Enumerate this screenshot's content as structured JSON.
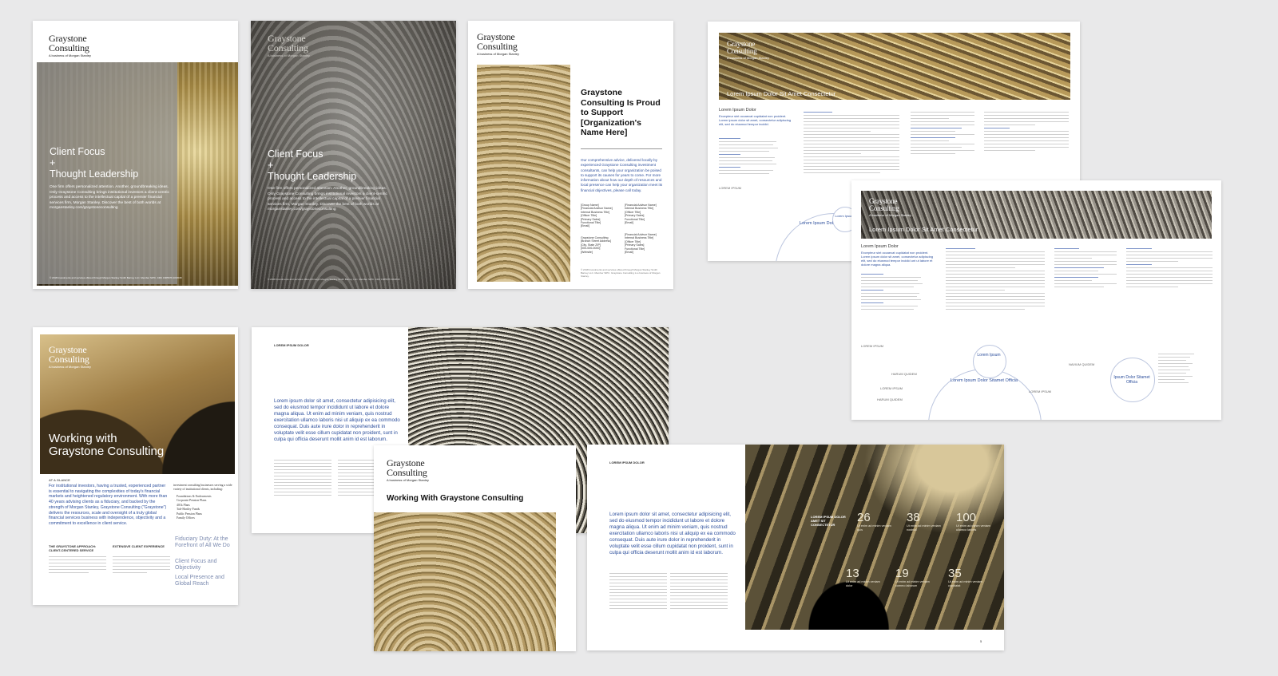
{
  "brand": {
    "name_line1": "Graystone",
    "name_line2": "Consulting",
    "tagline": "A business of Morgan Stanley"
  },
  "flyer1": {
    "title": "Client Focus\n+\nThought Leadership",
    "body": "One firm offers personalized attention. Another, groundbreaking ideas. Only Graystone Consulting brings institutional investors a client-centric process and access to the intellectual capital of a premier financial services firm, Morgan Stanley. Discover the best of both worlds at morganstanley.com/graystoneconsulting",
    "footer": "© 2018 Investments and services offered through Morgan Stanley Smith Barney LLC. Member SIPC. CRC 1665676 10/2018"
  },
  "flyer2": {
    "title": "Client Focus\n+\nThought Leadership",
    "body": "One firm offers personalized attention. Another, groundbreaking ideas. Only Graystone Consulting brings institutional investors a client-centric process and access to the intellectual capital of a premier financial services firm, Morgan Stanley. Discover the best of both worlds at morganstanley.com/graystoneconsulting",
    "footer": "© 2018 Investments and services offered through Morgan Stanley Smith Barney LLC. Member SIPC. CRC 1665676 10/2018"
  },
  "flyer3": {
    "title": "Graystone Consulting Is Proud to Support [Organization's Name Here]",
    "body": "Our comprehensive advice, delivered locally by experienced Graystone Consulting investment consultants, can help your organization be poised to support its causes for years to come. For more information about how our depth of resources and local presence can help your organization meet its financial objectives, please call today.",
    "contact1": "[Group Name]\n[Financial Advisor Name]\nInternal Business Title]\n[Officer Title]\n[Primary Sales]\nFunctional Title]\n[Email]",
    "contact2": "[Financial Advisor Name]\nInternal Business Title]\n[Officer Title]\n[Primary Sales]\nFunctional Title]\n[Email]",
    "contact3": "Graystone Consulting\n[Branch Street Address]\n[City, State ZIP]\n[000-000-0000]\n[Website]",
    "contact4": "[Financial Advisor Name]\nInternal Business Title]\n[Officer Title]\n[Primary Sales]\nFunctional Title]\n[Email]",
    "footer": "© 2018 Investments and services offered through Morgan Stanley Smith Barney LLC. Member SIPC. Graystone Consulting is a business of Morgan Stanley."
  },
  "spread1": {
    "banner_title": "Lorem Ipsum Dolor Sit Amet Consectetur",
    "section_title": "Lorem Ipsum Dolor",
    "intro": "Excepteur sint occaecat cupidatat non proident. Lorem ipsum dolor sit amet, consectetur adipiscing elit, sed do eiusmod tempor incidid.",
    "label": "LOREM IPSUM",
    "circle1": "Lorem Ipsum Dolor Sitamet Officia",
    "circle2": "Lorem Ipsum"
  },
  "spread2": {
    "banner_title": "Lorem Ipsum Dolor Sit Amet Consectetur",
    "section_title": "Lorem Ipsum Dolor",
    "intro": "Excepteur sint occaecat cupidatat non proident. Lorem ipsum dolor sit amet, consectetur adipiscing elit, sed do eiusmod tempor incidid unt ut labore et dolore magna aliqua.",
    "label": "LOREM IPSUM",
    "circle_left": "Lorem Ipsum Dolor Sitamet Officia",
    "circle_top": "Lorem Ipsum",
    "circle_right": "Ipsum Dolor Sitamet Officia",
    "small_labels": [
      "HARUM QUIDEM",
      "LOREM IPSUM",
      "NAVIUM QUIDEM",
      "HARUM QUIDEM",
      "LOREM IPSUM"
    ]
  },
  "working_flyer": {
    "title": "Working with\nGraystone Consulting",
    "label": "AT A GLANCE",
    "intro": "For institutional investors, having a trusted, experienced partner is essential to navigating the complexities of today's financial markets and heightened regulatory environment. With more than 40 years advising clients as a fiduciary, and backed by the strength of Morgan Stanley, Graystone Consulting (\"Graystone\") delivers the resources, scale and oversight of a truly global financial services business with independence, objectivity and a commitment to excellence in client service.",
    "list_intro": "investment consulting businesses serving a wide variety of institutional clients, including:",
    "list": [
      "Foundations & Endowments",
      "Corporate Pension Plans",
      "401k Plans",
      "Taft-Hartley Funds",
      "Public Pension Plans",
      "Family Offices"
    ],
    "sub1_title": "THE GRAYSTONE APPROACH: CLIENT-CENTERED SERVICE",
    "sub2_title": "EXTENSIVE CLIENT EXPERIENCE",
    "headings": [
      "Fiduciary Duty: At the Forefront of All We Do",
      "Client Focus and Objectivity",
      "Local Presence and Global Reach"
    ]
  },
  "brochure1": {
    "label": "LOREM IPSUM DOLOR",
    "lead": "Lorem ipsum dolor sit amet, consectetur adipisicing elit, sed do eiusmod tempor incididunt ut labore et dolore magna aliqua. Ut enim ad minim veniam, quis nostrud exercitation ullamco laboris nisi ut aliquip ex ea commodo consequat. Duis aute irure dolor in reprehenderit in voluptate velit esse cillum cupidatat non proident, sunt in culpa qui officia deserunt mollit anim id est laborum."
  },
  "brochure_cover": {
    "title": "Working With Graystone Consulting"
  },
  "brochure2": {
    "label": "LOREM IPSUM DOLOR",
    "lead": "Lorem ipsum dolor sit amet, consectetur adipisicing elit, sed do eiusmod tempor incididunt ut labore et dolore magna aliqua. Ut enim ad minim veniam, quis nostrud exercitation ullamco laboris nisi ut aliquip ex ea commodo consequat. Duis aute irure dolor in reprehenderit in voluptate velit esse cillum cupidatat non proident, sunt in culpa qui officia deserunt mollit anim id est laborum.",
    "photo_label": "LOREM IPSUM DOLOR AMET SIT CONSECTETUR",
    "stats": [
      {
        "value": "26",
        "caption": "Ut enim ad minim veniam quis"
      },
      {
        "value": "38",
        "caption": "Ut enim ad minim veniam nostrud"
      },
      {
        "value": "100",
        "caption": "Ut enim ad minim veniam ullamco laboris"
      },
      {
        "value": "13",
        "caption": "Ut enim ad minim veniam dolor"
      },
      {
        "value": "19",
        "caption": "Ut enim ad minim veniam commo laborum"
      },
      {
        "value": "35",
        "caption": "Ut enim ad minim veniam cupidatat"
      }
    ],
    "page_number": "5"
  }
}
